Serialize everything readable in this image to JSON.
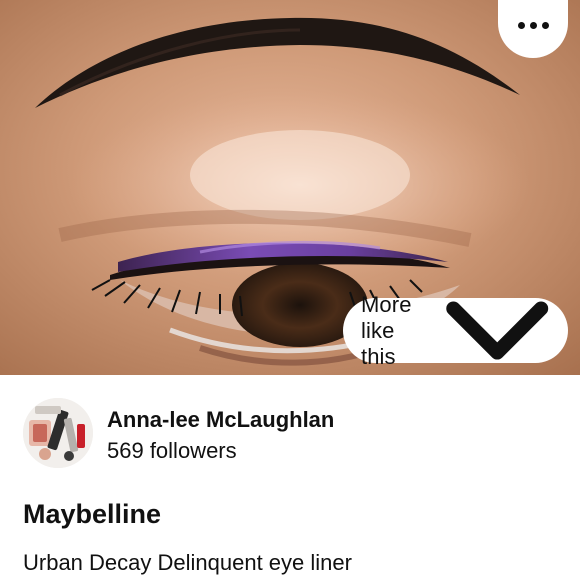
{
  "pin": {
    "image_subject": "close-up eye makeup photo",
    "more_like_this_label": "More like this",
    "title": "Maybelline",
    "description": "Urban Decay Delinquent eye liner"
  },
  "creator": {
    "name": "Anna-lee McLaughlan",
    "followers": "569 followers"
  },
  "icons": {
    "options": "more-options-icon",
    "more_like_this": "chevron-down-icon"
  },
  "colors": {
    "liner": "#6a3fa0",
    "skin": "#c08a63",
    "background": "#ffffff",
    "text": "#111111"
  }
}
